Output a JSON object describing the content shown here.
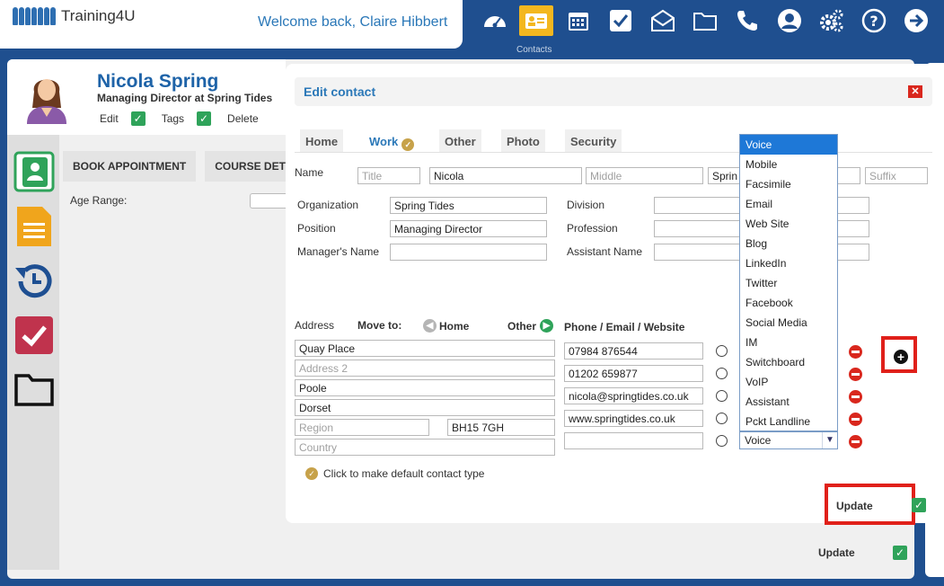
{
  "header": {
    "logo_text": "Training4U",
    "welcome": "Welcome back, Claire Hibbert",
    "active_label": "Contacts",
    "icons": [
      "dashboard-icon",
      "contacts-card-icon",
      "calendar-icon",
      "tasks-check-icon",
      "mail-icon",
      "folder-icon",
      "phone-icon",
      "user-icon",
      "settings-gears-icon",
      "help-icon",
      "logout-arrow-icon"
    ]
  },
  "profile": {
    "name": "Nicola Spring",
    "role": "Managing Director at Spring Tides",
    "actions": [
      "Edit",
      "Tags",
      "Delete"
    ]
  },
  "background_page": {
    "tabs": [
      "BOOK APPOINTMENT",
      "COURSE DET"
    ],
    "age_label": "Age Range:",
    "update_label": "Update"
  },
  "modal": {
    "title": "Edit contact",
    "tabs": [
      "Home",
      "Work",
      "Other",
      "Photo",
      "Security"
    ],
    "active_tab": "Work",
    "name": {
      "label": "Name",
      "title_placeholder": "Title",
      "first": "Nicola",
      "middle_placeholder": "Middle",
      "last": "Sprin",
      "suffix_placeholder": "Suffix"
    },
    "work": {
      "organization_label": "Organization",
      "organization": "Spring Tides",
      "position_label": "Position",
      "position": "Managing Director",
      "manager_label": "Manager's Name",
      "division_label": "Division",
      "profession_label": "Profession",
      "assistant_label": "Assistant Name"
    },
    "address": {
      "label": "Address",
      "move_to": "Move to:",
      "home_btn": "Home",
      "other_btn": "Other",
      "line1": "Quay Place",
      "line2_placeholder": "Address 2",
      "city": "Poole",
      "county": "Dorset",
      "region_placeholder": "Region",
      "postcode": "BH15 7GH",
      "country_placeholder": "Country"
    },
    "contact_methods": {
      "header": "Phone / Email / Website",
      "values": [
        "07984 876544",
        "01202 659877",
        "nicola@springtides.co.uk",
        "www.springtides.co.uk",
        ""
      ],
      "select_value": "Voice",
      "dropdown_options": [
        "Voice",
        "Mobile",
        "Facsimile",
        "Email",
        "Web Site",
        "Blog",
        "LinkedIn",
        "Twitter",
        "Facebook",
        "Social Media",
        "IM",
        "Switchboard",
        "VoIP",
        "Assistant",
        "Pckt Landline"
      ],
      "dropdown_selected": "Voice"
    },
    "default_note": "Click to make default contact type",
    "update_label": "Update"
  }
}
